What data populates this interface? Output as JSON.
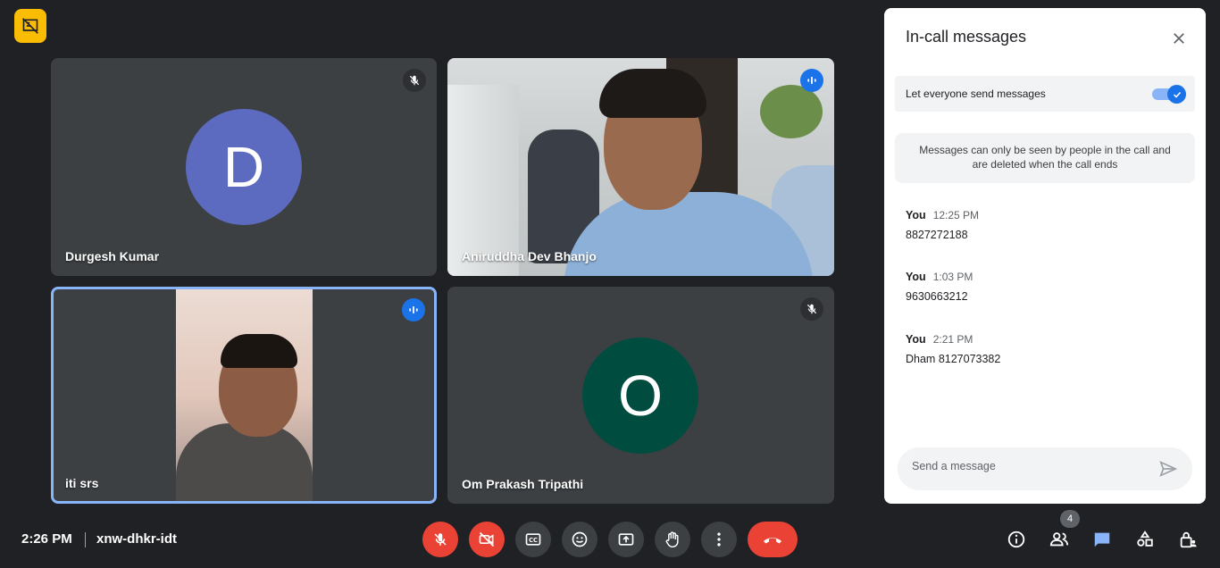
{
  "participants": [
    {
      "name": "Durgesh Kumar",
      "avatar_letter": "D",
      "avatar_color": "#5c6bc0",
      "muted": true
    },
    {
      "name": "Aniruddha Dev Bhanjo",
      "speaking": true
    },
    {
      "name": "iti srs",
      "speaking": true,
      "active": true
    },
    {
      "name": "Om Prakash Tripathi",
      "avatar_letter": "O",
      "avatar_color": "#004d40",
      "muted": true
    }
  ],
  "panel": {
    "title": "In-call messages",
    "toggle_label": "Let everyone send messages",
    "toggle_on": true,
    "info": "Messages can only be seen by people in the call and are deleted when the call ends",
    "messages": [
      {
        "sender": "You",
        "time": "12:25 PM",
        "text": "8827272188"
      },
      {
        "sender": "You",
        "time": "1:03 PM",
        "text": "9630663212"
      },
      {
        "sender": "You",
        "time": "2:21 PM",
        "text": "Dham 8127073382"
      }
    ],
    "composer_placeholder": "Send a message"
  },
  "bottom": {
    "time": "2:26 PM",
    "meeting_code": "xnw-dhkr-idt",
    "participant_count": "4"
  },
  "colors": {
    "background": "#202124",
    "tile": "#3c4043",
    "accent": "#8ab4f8",
    "danger": "#ea4335",
    "badge": "#fbbc04"
  }
}
